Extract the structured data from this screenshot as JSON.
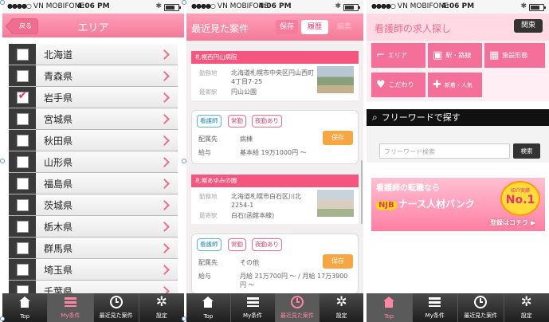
{
  "status": {
    "carrier": "VN MOBIFONE",
    "time": "4:06 PM"
  },
  "tabbar": [
    "Top",
    "My条件",
    "最近見た案件",
    "設定"
  ],
  "screen1": {
    "title": "エリア",
    "back": "戻る",
    "areas": [
      {
        "name": "北海道",
        "checked": false
      },
      {
        "name": "青森県",
        "checked": false
      },
      {
        "name": "岩手県",
        "checked": true
      },
      {
        "name": "宮城県",
        "checked": false
      },
      {
        "name": "秋田県",
        "checked": false
      },
      {
        "name": "山形県",
        "checked": false
      },
      {
        "name": "福島県",
        "checked": false
      },
      {
        "name": "茨城県",
        "checked": false
      },
      {
        "name": "栃木県",
        "checked": false
      },
      {
        "name": "群馬県",
        "checked": false
      },
      {
        "name": "埼玉県",
        "checked": false
      },
      {
        "name": "千葉県",
        "checked": false
      }
    ]
  },
  "screen2": {
    "title": "最近見た案件",
    "seg_save": "保存",
    "seg_history": "履歴",
    "seg_edit": "編集",
    "labels": {
      "location": "勤務地",
      "station": "最寄駅",
      "placement": "配属先",
      "salary": "給与"
    },
    "save_button": "保存",
    "jobs": [
      {
        "name": "札幌西円山病院",
        "location": "北海道札幌市中央区円山西町4丁目7-25",
        "station": "円山公園",
        "tags": [
          {
            "text": "看護師",
            "color": "blue"
          },
          {
            "text": "常勤",
            "color": "pink"
          },
          {
            "text": "夜勤あり",
            "color": "pink"
          }
        ],
        "placement": "病棟",
        "salary": "基本給 19万1000円 〜"
      },
      {
        "name": "札幌あゆみの園",
        "location": "北海道札幌市白石区川北2254-1",
        "station": "白石(函館本線)",
        "tags": [
          {
            "text": "看護師",
            "color": "blue"
          },
          {
            "text": "常勤",
            "color": "pink"
          },
          {
            "text": "夜勤あり",
            "color": "pink"
          }
        ],
        "placement": "その他",
        "salary": "月給 21万700円 〜 / 月給 17万3900円 〜"
      }
    ]
  },
  "screen3": {
    "title": "看護師の求人探し",
    "close": "関東",
    "menu": [
      {
        "label": "エリア",
        "icon": "stairs-icon"
      },
      {
        "label": "駅・路線",
        "icon": "train-icon"
      },
      {
        "label": "施設形態",
        "icon": "building-icon"
      },
      {
        "label": "こだわり",
        "icon": "heart-icon"
      },
      {
        "label": "新着・人気",
        "icon": "new-icon"
      }
    ],
    "freeword_title": "フリーワードで探す",
    "freeword_placeholder": "フリーワード検索",
    "search_button": "検索",
    "banner": {
      "line1": "看護師の転職なら",
      "logo": "NJB",
      "line2": "ナース人材バンク",
      "badge_top": "紹介実績",
      "badge": "No.1",
      "cta": "登録はコチラ ▶"
    }
  }
}
